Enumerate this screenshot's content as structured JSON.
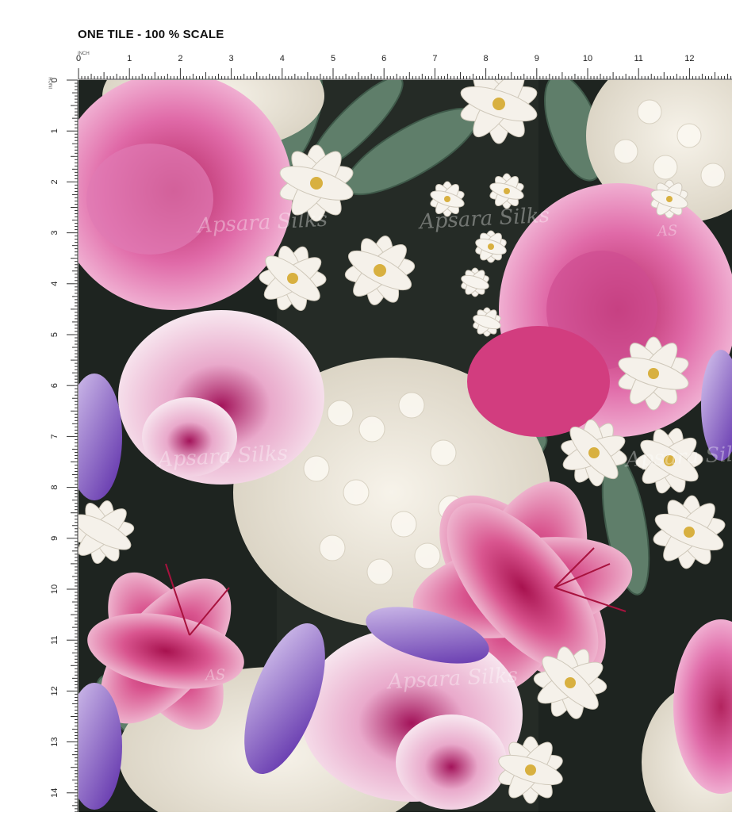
{
  "header": {
    "title": "ONE TILE - 100 % SCALE"
  },
  "ruler": {
    "unit": "INCH",
    "top_ticks": [
      "0",
      "1",
      "2",
      "3",
      "4",
      "5",
      "6",
      "7",
      "8",
      "9",
      "10",
      "11",
      "12"
    ],
    "left_ticks": [
      "0",
      "1",
      "2",
      "3",
      "4",
      "5",
      "6",
      "7",
      "8",
      "9",
      "10",
      "11",
      "12",
      "13",
      "14"
    ]
  },
  "watermark": {
    "brand": "Apsara Silks",
    "monogram": "AS"
  },
  "colors": {
    "background": "#ffffff",
    "fabric_dark": "#1e2420",
    "rose_pink": "#d9559c",
    "hydrangea_white": "#efe9dc",
    "leaf_green": "#5f7e6a",
    "iris_purple": "#6a3fb0",
    "lily_magenta": "#c8236e"
  }
}
